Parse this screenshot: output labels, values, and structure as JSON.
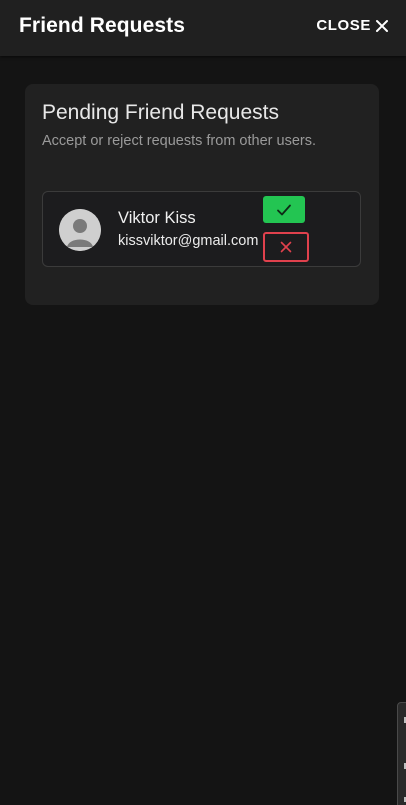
{
  "header": {
    "title": "Friend Requests",
    "close_label": "CLOSE"
  },
  "card": {
    "title": "Pending Friend Requests",
    "subtitle": "Accept or reject requests from other users."
  },
  "requests": [
    {
      "name": "Viktor Kiss",
      "email": "kissviktor@gmail.com",
      "avatar_icon": "default-user-avatar-icon",
      "accept_icon": "check-icon",
      "reject_icon": "x-icon"
    }
  ],
  "colors": {
    "background": "#141414",
    "header": "#202020",
    "card": "#212121",
    "accept": "#23c552",
    "reject": "#e0414d"
  }
}
